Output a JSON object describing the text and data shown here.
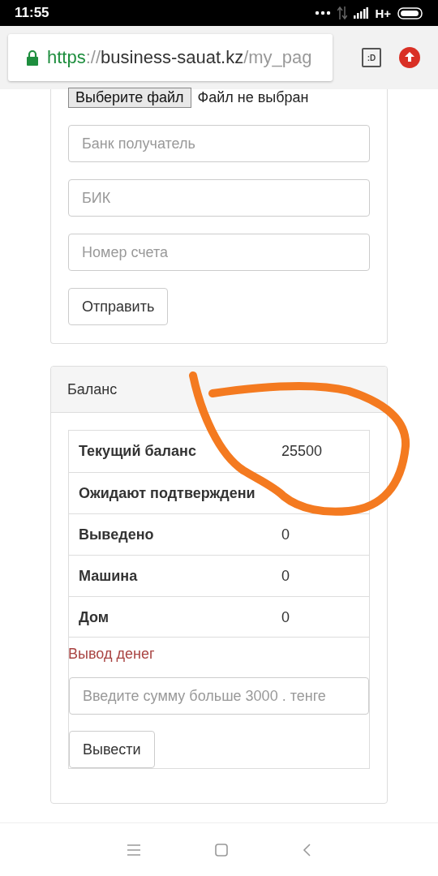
{
  "status_bar": {
    "time": "11:55",
    "network": "H+"
  },
  "browser": {
    "url_scheme": "https",
    "url_separator": "://",
    "url_host": "business-sauat.kz",
    "url_path": "/my_pag",
    "tab_count": ":D"
  },
  "upload_form": {
    "file_button": "Выберите файл",
    "file_status": "Файл не выбран",
    "fields": [
      {
        "placeholder": "Банк получатель"
      },
      {
        "placeholder": "БИК"
      },
      {
        "placeholder": "Номер счета"
      }
    ],
    "submit": "Отправить"
  },
  "balance": {
    "title": "Баланс",
    "rows": [
      {
        "label": "Текущий баланс",
        "value": "25500"
      },
      {
        "label": "Ожидают подтверждени"
      },
      {
        "label": "Выведено",
        "value": "0"
      },
      {
        "label": "Машина",
        "value": "0"
      },
      {
        "label": "Дом",
        "value": "0"
      }
    ],
    "withdraw_title": "Вывод денег",
    "amount_placeholder": "Введите сумму больше 3000 . тенге",
    "withdraw_button": "Вывести"
  }
}
